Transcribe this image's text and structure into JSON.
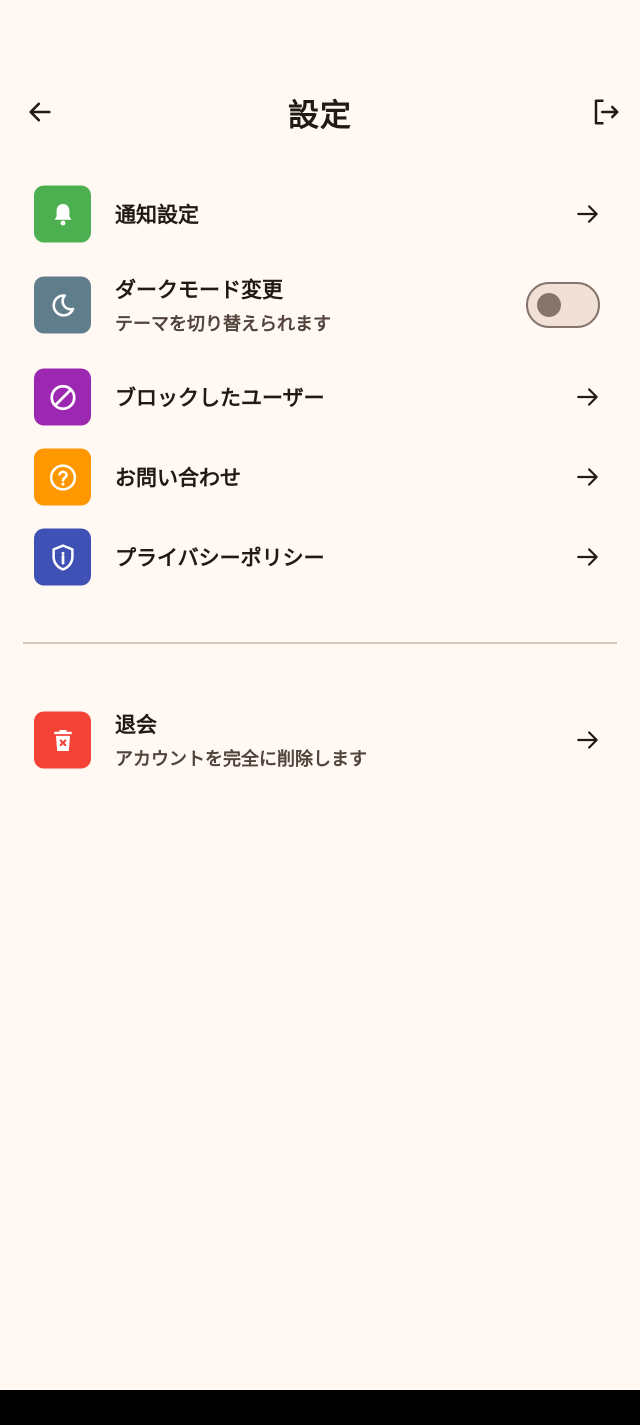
{
  "header": {
    "title": "設定",
    "back_icon": "arrow-left-icon",
    "logout_icon": "logout-icon"
  },
  "settings": {
    "notifications": {
      "label": "通知設定",
      "icon": "bell-icon",
      "color": "#4caf50"
    },
    "dark_mode": {
      "label": "ダークモード変更",
      "sub": "テーマを切り替えられます",
      "icon": "moon-icon",
      "color": "#607d8b",
      "enabled": false
    },
    "blocked_users": {
      "label": "ブロックしたユーザー",
      "icon": "block-icon",
      "color": "#9c27b0"
    },
    "contact": {
      "label": "お問い合わせ",
      "icon": "help-icon",
      "color": "#ff9800"
    },
    "privacy": {
      "label": "プライバシーポリシー",
      "icon": "shield-icon",
      "color": "#3f51b5"
    }
  },
  "danger": {
    "withdraw": {
      "label": "退会",
      "sub": "アカウントを完全に削除します",
      "icon": "trash-icon",
      "color": "#f44336"
    }
  }
}
